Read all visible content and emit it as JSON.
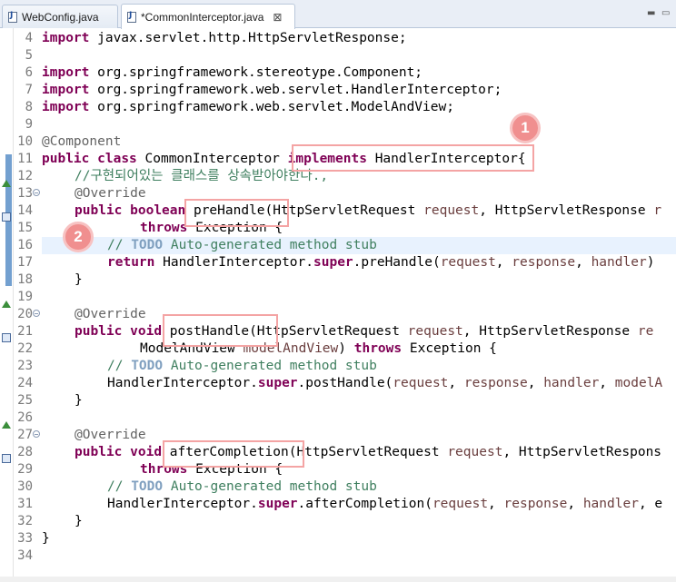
{
  "tabs": [
    {
      "label": "WebConfig.java",
      "active": false
    },
    {
      "label": "*CommonInterceptor.java",
      "active": true,
      "close": "⊠"
    }
  ],
  "window_controls": {
    "minimize": "▬",
    "maximize": "▭"
  },
  "line_numbers": [
    "4",
    "5",
    "6",
    "7",
    "8",
    "9",
    "10",
    "11",
    "12",
    "13",
    "14",
    "15",
    "16",
    "17",
    "18",
    "19",
    "20",
    "21",
    "22",
    "23",
    "24",
    "25",
    "26",
    "27",
    "28",
    "29",
    "30",
    "31",
    "32",
    "33",
    "34"
  ],
  "code": {
    "l4": {
      "kw": "import",
      "rest": " javax.servlet.http.HttpServletResponse;"
    },
    "l6": {
      "kw": "import",
      "rest": " org.springframework.stereotype.Component;"
    },
    "l7": {
      "kw": "import",
      "rest": " org.springframework.web.servlet.HandlerInterceptor;"
    },
    "l8": {
      "kw": "import",
      "rest": " org.springframework.web.servlet.ModelAndView;"
    },
    "l10": {
      "ann": "@Component"
    },
    "l11": {
      "kw1": "public",
      "kw2": "class",
      "name": " CommonInterceptor ",
      "kw3": "implements",
      "rest": " HandlerInterceptor{"
    },
    "l12": {
      "comment": "//구현되어있는 클래스를 상속받아야한다.,"
    },
    "l13": {
      "ann": "@Override"
    },
    "l14": {
      "kw1": "public",
      "kw2": "boolean",
      "m": " preHandle(HttpServletRequest ",
      "p1": "request",
      "m2": ", HttpServletResponse ",
      "p2": "r"
    },
    "l15": {
      "kw": "throws",
      "rest": " Exception {"
    },
    "l16": {
      "c1": "// ",
      "todo": "TODO",
      "c2": " Auto-generated method stub"
    },
    "l17": {
      "kw": "return",
      "m": " HandlerInterceptor.",
      "kw2": "super",
      "m2": ".preHandle(",
      "p1": "request",
      "s1": ", ",
      "p2": "response",
      "s2": ", ",
      "p3": "handler",
      "s3": ")"
    },
    "l18": {
      "text": "}"
    },
    "l20": {
      "ann": "@Override"
    },
    "l21": {
      "kw1": "public",
      "kw2": "void",
      "m": " postHandle(HttpServletRequest ",
      "p1": "request",
      "m2": ", HttpServletResponse ",
      "p2": "re"
    },
    "l22": {
      "m": "ModelAndView ",
      "p1": "modelAndView",
      "s": ") ",
      "kw": "throws",
      "rest": " Exception {"
    },
    "l23": {
      "c1": "// ",
      "todo": "TODO",
      "c2": " Auto-generated method stub"
    },
    "l24": {
      "m": "HandlerInterceptor.",
      "kw": "super",
      "m2": ".postHandle(",
      "p1": "request",
      "s1": ", ",
      "p2": "response",
      "s2": ", ",
      "p3": "handler",
      "s3": ", ",
      "p4": "modelA"
    },
    "l25": {
      "text": "}"
    },
    "l27": {
      "ann": "@Override"
    },
    "l28": {
      "kw1": "public",
      "kw2": "void",
      "m": " afterCompletion(HttpServletRequest ",
      "p1": "request",
      "m2": ", HttpServletRespons"
    },
    "l29": {
      "kw": "throws",
      "rest": " Exception {"
    },
    "l30": {
      "c1": "// ",
      "todo": "TODO",
      "c2": " Auto-generated method stub"
    },
    "l31": {
      "m": "HandlerInterceptor.",
      "kw": "super",
      "m2": ".afterCompletion(",
      "p1": "request",
      "s1": ", ",
      "p2": "response",
      "s2": ", ",
      "p3": "handler",
      "s3": ", e"
    },
    "l32": {
      "text": "}"
    },
    "l33": {
      "text": "}"
    }
  },
  "annotations": {
    "badge1": "1",
    "badge2": "2"
  },
  "colors": {
    "keyword": "#7f0055",
    "comment": "#3f7f5f",
    "annotation_box": "#f4a4a4",
    "badge": "#f08f8f"
  }
}
